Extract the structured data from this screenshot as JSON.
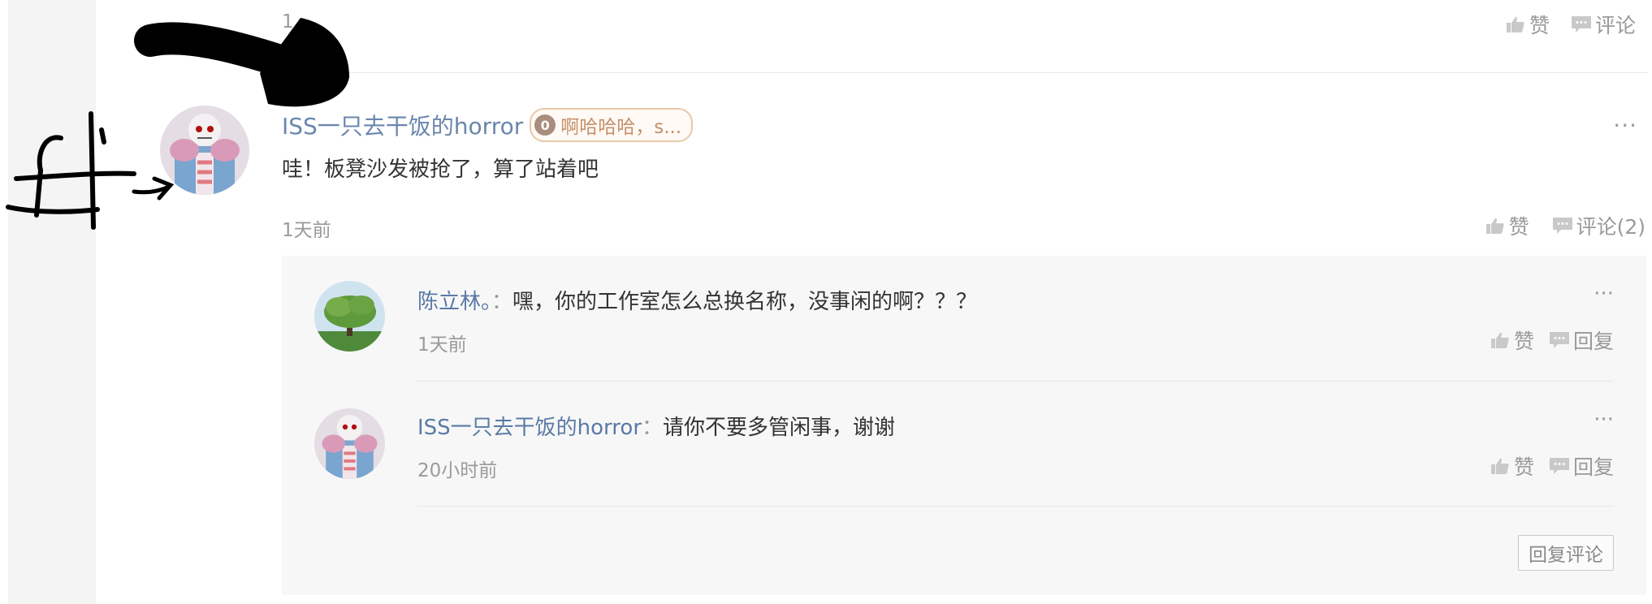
{
  "top_row": {
    "time_partial": "1",
    "like_label": "赞",
    "comment_label": "评论"
  },
  "main_comment": {
    "author": "ISS一只去干饭的horror",
    "badge_level": "0",
    "badge_text": "啊哈哈哈，s...",
    "content": "哇！板凳沙发被抢了，算了站着吧",
    "time": "1天前",
    "like_label": "赞",
    "comment_label": "评论(2)",
    "more_label": "···"
  },
  "replies": [
    {
      "author": "陈立林。",
      "separator": "：",
      "text": "嘿，你的工作室怎么总换名称，没事闲的啊？？？",
      "time": "1天前",
      "like_label": "赞",
      "reply_label": "回复",
      "more_label": "···"
    },
    {
      "author": "ISS一只去干饭的horror",
      "separator": "：",
      "text": "请你不要多管闲事，谢谢",
      "time": "20小时前",
      "like_label": "赞",
      "reply_label": "回复",
      "more_label": "···"
    }
  ],
  "reply_comment_button": "回复评论",
  "colors": {
    "name": "#6b86ad",
    "muted": "#9a9a9a",
    "badge_border": "#e7c9a8",
    "reply_bg": "#f7f7f7",
    "annotation_ink": "#000000"
  },
  "icons": [
    "thumb-up-icon",
    "comment-bubble-icon",
    "more-icon"
  ]
}
